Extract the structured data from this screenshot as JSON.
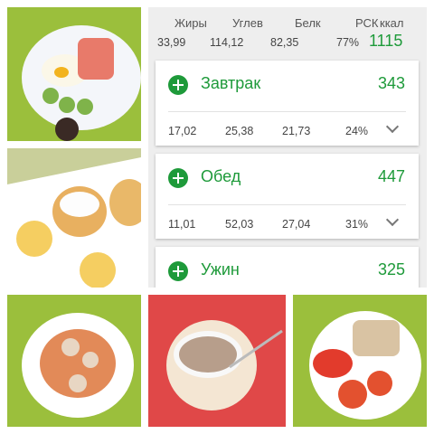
{
  "totals": {
    "headers": [
      "Жиры",
      "Углев",
      "Белк",
      "РСК",
      "ккал"
    ],
    "values": [
      "33,99",
      "114,12",
      "82,35",
      "77%",
      "1115"
    ]
  },
  "meals": [
    {
      "name": "Завтрак",
      "kcal": "343",
      "fat": "17,02",
      "carbs": "25,38",
      "protein": "21,73",
      "rsk": "24%"
    },
    {
      "name": "Обед",
      "kcal": "447",
      "fat": "11,01",
      "carbs": "52,03",
      "protein": "27,04",
      "rsk": "31%"
    },
    {
      "name": "Ужин",
      "kcal": "325"
    }
  ],
  "icons": {
    "add": "plus-circle-icon",
    "expand": "chevron-down-icon"
  },
  "colors": {
    "accent": "#1e9a3a",
    "panel_bg": "#eeeeee",
    "placemat": "#9bbf3c"
  }
}
